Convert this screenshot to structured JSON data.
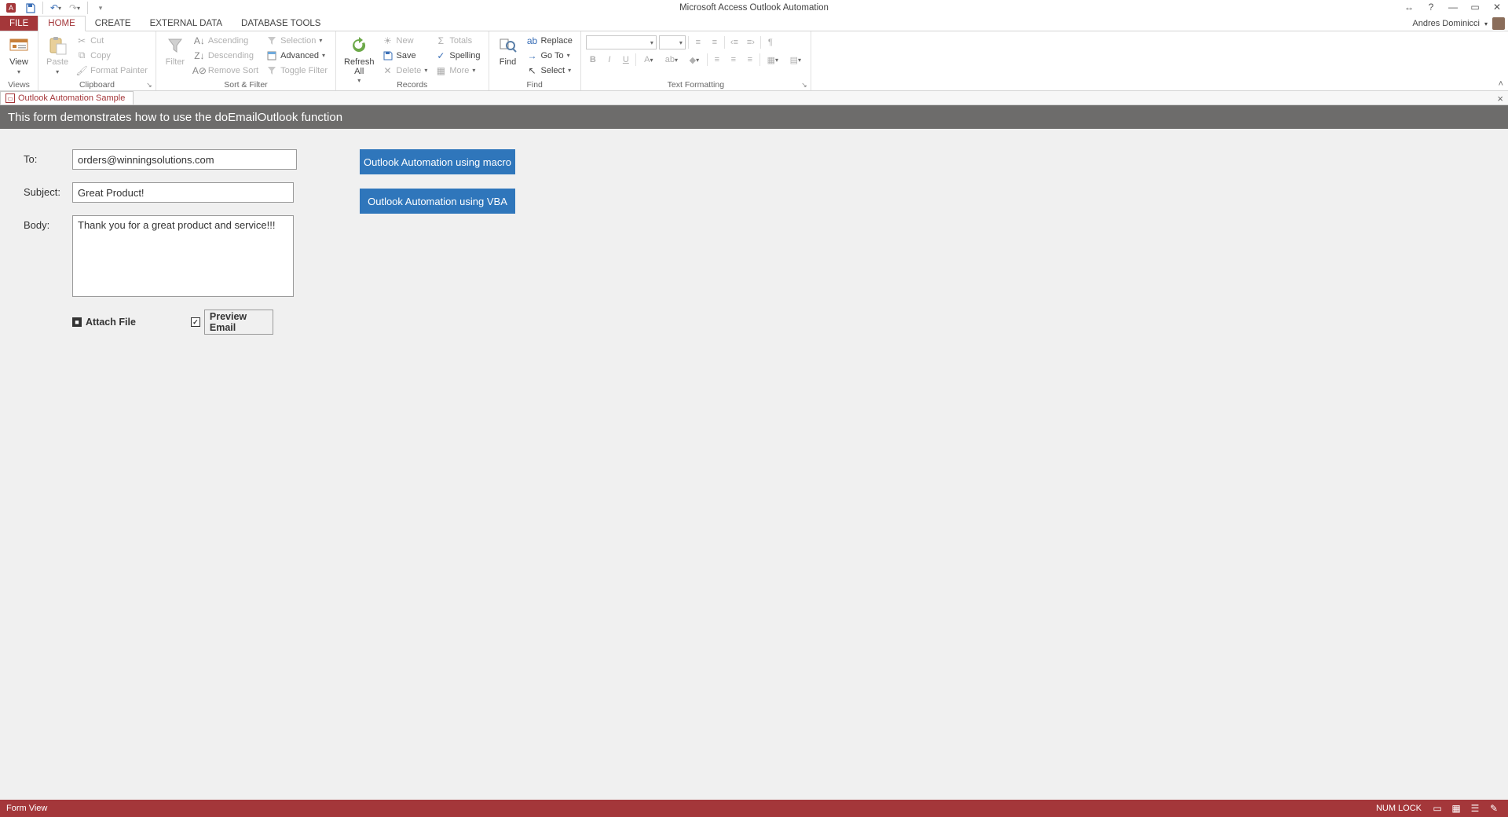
{
  "app": {
    "title": "Microsoft Access Outlook Automation"
  },
  "user": {
    "name": "Andres Dominicci"
  },
  "tabs": {
    "file": "FILE",
    "home": "HOME",
    "create": "CREATE",
    "external": "EXTERNAL DATA",
    "dbtools": "DATABASE TOOLS"
  },
  "ribbon": {
    "views": {
      "view": "View",
      "group": "Views"
    },
    "clipboard": {
      "paste": "Paste",
      "cut": "Cut",
      "copy": "Copy",
      "formatpainter": "Format Painter",
      "group": "Clipboard"
    },
    "sortfilter": {
      "filter": "Filter",
      "asc": "Ascending",
      "desc": "Descending",
      "remove": "Remove Sort",
      "selection": "Selection",
      "advanced": "Advanced",
      "toggle": "Toggle Filter",
      "group": "Sort & Filter"
    },
    "records": {
      "refresh": "Refresh\nAll",
      "new": "New",
      "save": "Save",
      "delete": "Delete",
      "totals": "Totals",
      "spelling": "Spelling",
      "more": "More",
      "group": "Records"
    },
    "find": {
      "find": "Find",
      "replace": "Replace",
      "goto": "Go To",
      "select": "Select",
      "group": "Find"
    },
    "textfmt": {
      "group": "Text Formatting"
    }
  },
  "doctab": {
    "label": "Outlook Automation Sample"
  },
  "form": {
    "header": "This form demonstrates how to use the doEmailOutlook function",
    "to_label": "To:",
    "to_value": "orders@winningsolutions.com",
    "subject_label": "Subject:",
    "subject_value": "Great Product!",
    "body_label": "Body:",
    "body_value": "Thank you for a great product and service!!!",
    "attach_label": "Attach File",
    "preview_label": "Preview Email",
    "btn_macro": "Outlook Automation using macro",
    "btn_vba": "Outlook Automation using VBA"
  },
  "status": {
    "left": "Form View",
    "numlock": "NUM LOCK"
  }
}
